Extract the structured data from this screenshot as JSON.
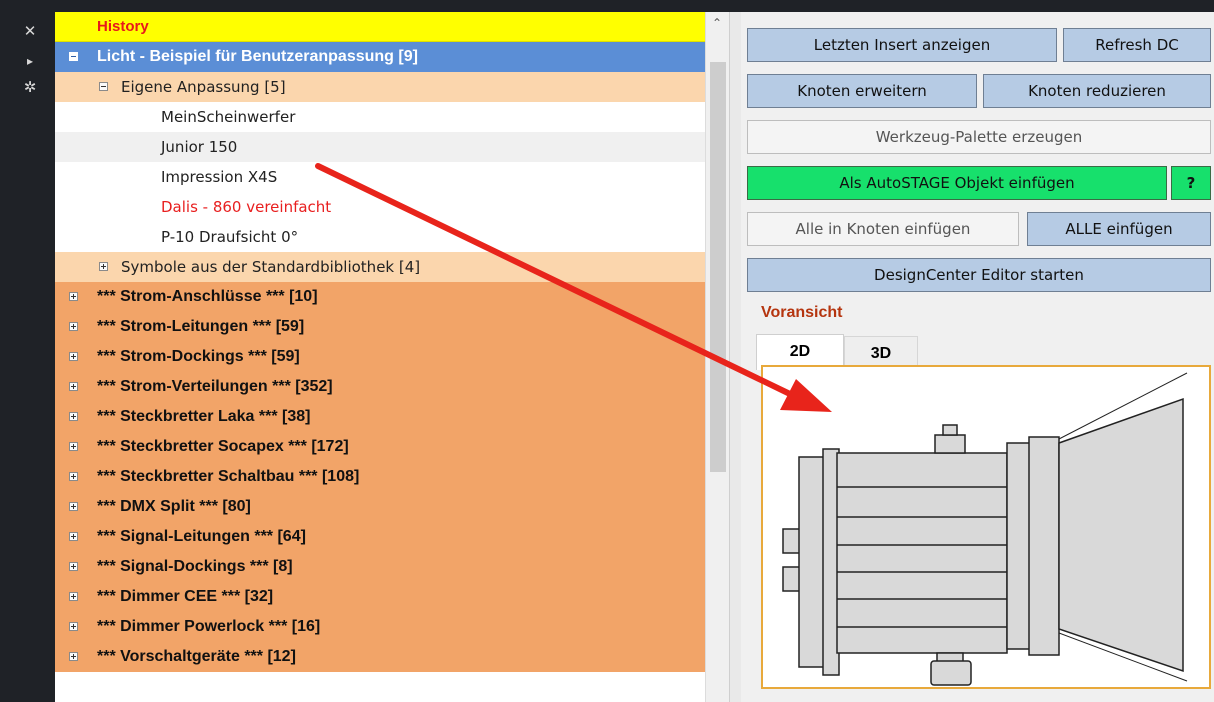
{
  "sidebar_icons": [
    "close-icon",
    "pin-icon",
    "settings-icon"
  ],
  "tree": {
    "history_label": "History",
    "root": {
      "label": "Licht - Beispiel für Benutzeranpassung  [9]"
    },
    "subgroups": [
      {
        "label": "Eigene Anpassung  [5]",
        "expanded": true
      },
      {
        "label": "Symbole aus der Standardbibliothek  [4]",
        "expanded": false
      }
    ],
    "items": [
      {
        "label": "MeinScheinwerfer"
      },
      {
        "label": "Junior 150"
      },
      {
        "label": "Impression X4S"
      },
      {
        "label": "Dalis - 860 vereinfacht",
        "color": "#e81f1f"
      },
      {
        "label": "P-10 Draufsicht 0°"
      }
    ],
    "categories": [
      {
        "label": "*** Strom-Anschlüsse ***   [10]"
      },
      {
        "label": "*** Strom-Leitungen ***   [59]"
      },
      {
        "label": "*** Strom-Dockings ***   [59]"
      },
      {
        "label": "*** Strom-Verteilungen ***   [352]"
      },
      {
        "label": "*** Steckbretter Laka ***   [38]"
      },
      {
        "label": "*** Steckbretter Socapex ***   [172]"
      },
      {
        "label": "*** Steckbretter Schaltbau ***   [108]"
      },
      {
        "label": "*** DMX Split ***   [80]"
      },
      {
        "label": "*** Signal-Leitungen ***   [64]"
      },
      {
        "label": "*** Signal-Dockings ***   [8]"
      },
      {
        "label": "*** Dimmer CEE ***   [32]"
      },
      {
        "label": "*** Dimmer Powerlock ***   [16]"
      },
      {
        "label": "*** Vorschaltgeräte ***   [12]"
      }
    ]
  },
  "buttons": {
    "show_last_insert": "Letzten Insert anzeigen",
    "refresh_dc": "Refresh DC",
    "expand_nodes": "Knoten erweitern",
    "collapse_nodes": "Knoten reduzieren",
    "create_palette": "Werkzeug-Palette erzeugen",
    "insert_autostage": "Als AutoSTAGE Objekt einfügen",
    "help": "?",
    "insert_all_in_node": "Alle in Knoten einfügen",
    "insert_all": "ALLE einfügen",
    "start_editor": "DesignCenter Editor starten"
  },
  "preview": {
    "label": "Voransicht",
    "tabs": [
      "2D",
      "3D"
    ],
    "active_tab": "2D"
  },
  "colors": {
    "history_bg": "#ffff00",
    "selected_bg": "#5b8ed6",
    "subgroup_bg": "#fbd6ad",
    "category_bg": "#f2a468",
    "button_bg": "#b6cbe4",
    "green_button_bg": "#17e06c",
    "annotation_arrow": "#e8241b"
  }
}
